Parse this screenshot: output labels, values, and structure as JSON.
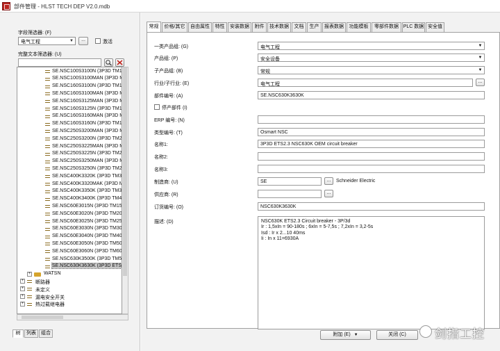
{
  "window": {
    "title": "部件管理 - HLST TECH DEP V2.0.mdb"
  },
  "left": {
    "field_filter_label": "字段筛选器: (F)",
    "field_filter_value": "电气工程",
    "ellipsis": "...",
    "activate_label": "激活",
    "fulltext_filter_label": "完整文本筛选器: (U)",
    "fulltext_value": "",
    "tree_items": [
      "SE.NSC100S3100N (3P3D TM1",
      "SE.NSC100S3100MAN (3P3D M",
      "SE.NSC160S3100N (3P3D TM1",
      "SE.NSC160S3100MAN (3P3D M",
      "SE.NSC160S3125MAN (3P3D M",
      "SE.NSC160S3125N (3P3D TM1",
      "SE.NSC160S3160MAN (3P3D M",
      "SE.NSC160S3160N (3P3D TM1",
      "SE.NSC250S3200MAN (3P3D M",
      "SE.NSC250S3200N (3P3D TM2",
      "SE.NSC250S3225MAN (3P3D M",
      "SE.NSC250S3225N (3P3D TM2",
      "SE.NSC250S3250MAN (3P3D M",
      "SE.NSC250S3250N (3P3D TM2",
      "SE.NSC400K3320K (3P3D TM3",
      "SE.NSC400K3320MAK (3P3D M",
      "SE.NSC400K3350K (3P3D TM3",
      "SE.NSC400K3400K (3P3D TM4",
      "SE.NSC60E3015N (3P3D TM15",
      "SE.NSC60E3020N (3P3D TM20",
      "SE.NSC60E3025N (3P3D TM25",
      "SE.NSC60E3030N (3P3D TM30",
      "SE.NSC60E3040N (3P3D TM40",
      "SE.NSC60E3050N (3P3D TM50",
      "SE.NSC60E3060N (3P3D TM60",
      "SE.NSC630K3500K (3P3D TM5",
      "SE.NSC630K3630K (3P3D ETS2"
    ],
    "tree_groups": [
      "WATSN",
      "断路器",
      "未定义",
      "漏电安全开关",
      "热过载继电器"
    ],
    "bottom_tabs": [
      "树",
      "列表",
      "组合"
    ]
  },
  "tabs": [
    "常规",
    "价格/其它",
    "自由属性",
    "特性",
    "安装数据",
    "附件",
    "技术数据",
    "文档",
    "生产",
    "报表数据",
    "功能模板",
    "零部件数据",
    "PLC 数据",
    "安全值"
  ],
  "form": {
    "rows": [
      {
        "label": "一类产品组: (G)",
        "value": "电气工程",
        "kind": "select"
      },
      {
        "label": "产品组: (P)",
        "value": "安全设备",
        "kind": "select"
      },
      {
        "label": "子产品组: (B)",
        "value": "常规",
        "kind": "select"
      },
      {
        "label": "行业/子行业: (E)",
        "value": "电气工程",
        "kind": "ellipsis"
      },
      {
        "label": "部件编号: (A)",
        "value": "SE.NSC630K3630K",
        "kind": "text"
      },
      {
        "label": "停产部件 (I)",
        "value": "",
        "kind": "checkbox"
      },
      {
        "label": "ERP 编号: (N)",
        "value": "",
        "kind": "text"
      },
      {
        "label": "类型编号: (T)",
        "value": "Osmart NSC",
        "kind": "text"
      },
      {
        "label": "名称1:",
        "value": "3P3D ETS2.3 NSC630K OEM circuit breaker",
        "kind": "text"
      },
      {
        "label": "名称2:",
        "value": "",
        "kind": "text"
      },
      {
        "label": "名称3:",
        "value": "",
        "kind": "text"
      },
      {
        "label": "制造商: (U)",
        "value": "SE",
        "kind": "ellipsis-short",
        "extra": "Schneider Electric"
      },
      {
        "label": "供应商: (R)",
        "value": "",
        "kind": "ellipsis-short",
        "extra": ""
      },
      {
        "label": "订货编号: (O)",
        "value": "NSC630K3630K",
        "kind": "text"
      }
    ],
    "desc_label": "描述: (D)",
    "desc_lines": [
      "NSC630K ETS2.3 Circuit breaker - 3P/3d",
      "Ir : 1,5xIn = 90-180s ; 6xIn = 5-7,5s ; 7,2xIn = 3,2-5s",
      "Isd : Ir x 2...10  40ms",
      "Ii : In x 11=6930A"
    ]
  },
  "footer": {
    "add_label": "附加 (E)",
    "close_label": "关闭 (C)"
  },
  "watermark": {
    "text": "剑指工控"
  }
}
